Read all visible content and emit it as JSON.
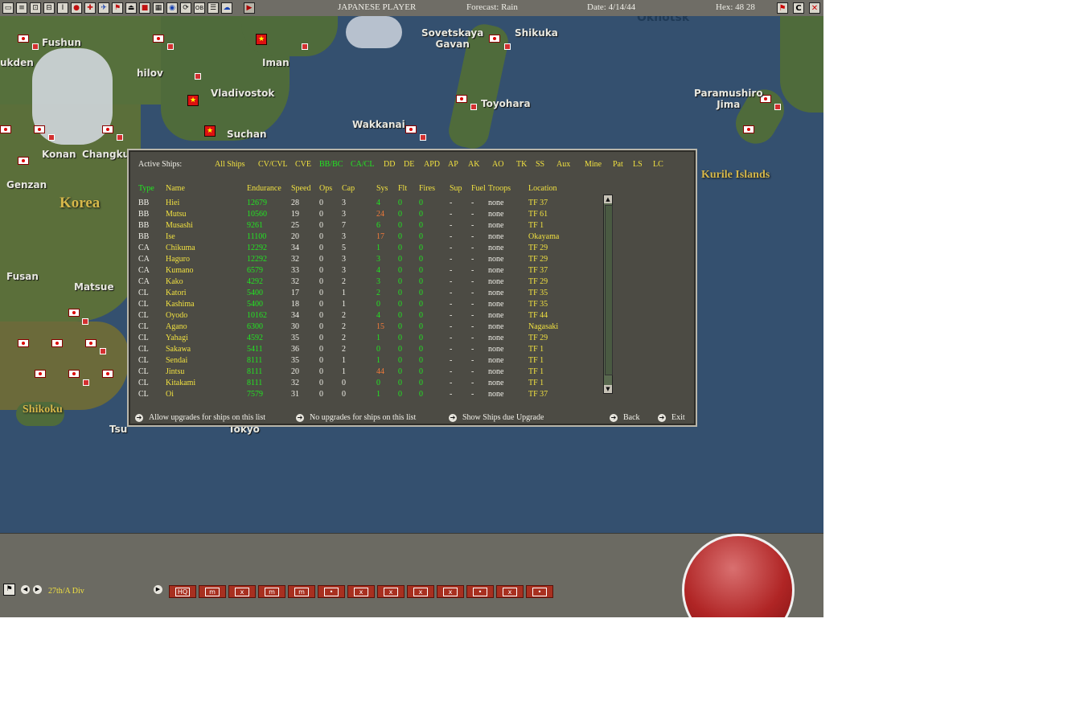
{
  "topbar": {
    "player": "JAPANESE PLAYER",
    "forecast": "Forecast: Rain",
    "date": "Date: 4/14/44",
    "hex": "Hex: 48  28",
    "icons": [
      "map-icon",
      "report-icon",
      "tf-icon",
      "ship-icon",
      "info-icon",
      "flag-jp-icon",
      "air-icon",
      "plane-icon",
      "fortify-icon",
      "sub-icon",
      "balance-icon",
      "grid-icon",
      "globe-icon",
      "cycle-icon",
      "ob-icon",
      "list-icon",
      "cloud-icon",
      "play-icon"
    ],
    "right_icons": [
      "flag-icon",
      "c-icon",
      "close-icon"
    ]
  },
  "map": {
    "cities": [
      {
        "name": "Fushun"
      },
      {
        "name": "ukden"
      },
      {
        "name": "hilov"
      },
      {
        "name": "Vladivostok"
      },
      {
        "name": "Iman"
      },
      {
        "name": "Sovetskaya\nGavan"
      },
      {
        "name": "Shikuka"
      },
      {
        "name": "Toyohara"
      },
      {
        "name": "Paramushiro\nJima"
      },
      {
        "name": "Suchan"
      },
      {
        "name": "Wakkanai"
      },
      {
        "name": "Konan"
      },
      {
        "name": "Changkufe"
      },
      {
        "name": "Genzan"
      },
      {
        "name": "Fusan"
      },
      {
        "name": "Matsue"
      },
      {
        "name": "Tokyo"
      },
      {
        "name": "Tsu"
      },
      {
        "name": "Okhotsk"
      }
    ],
    "regions": [
      {
        "name": "Korea"
      },
      {
        "name": "Kurile Islands"
      },
      {
        "name": "Shikoku"
      }
    ]
  },
  "dialog": {
    "active_label": "Active Ships:",
    "filters": [
      {
        "label": "All Ships",
        "color": "yellow"
      },
      {
        "label": "CV/CVL",
        "color": "yellow"
      },
      {
        "label": "CVE",
        "color": "yellow"
      },
      {
        "label": "BB/BC",
        "color": "green"
      },
      {
        "label": "CA/CL",
        "color": "green"
      },
      {
        "label": "DD",
        "color": "yellow"
      },
      {
        "label": "DE",
        "color": "yellow"
      },
      {
        "label": "APD",
        "color": "yellow"
      },
      {
        "label": "AP",
        "color": "yellow"
      },
      {
        "label": "AK",
        "color": "yellow"
      },
      {
        "label": "AO",
        "color": "yellow"
      },
      {
        "label": "TK",
        "color": "yellow"
      },
      {
        "label": "SS",
        "color": "yellow"
      },
      {
        "label": "Aux",
        "color": "yellow"
      },
      {
        "label": "Mine",
        "color": "yellow"
      },
      {
        "label": "Pat",
        "color": "yellow"
      },
      {
        "label": "LS",
        "color": "yellow"
      },
      {
        "label": "LC",
        "color": "yellow"
      }
    ],
    "columns": [
      "Type",
      "Name",
      "Endurance",
      "Speed",
      "Ops",
      "Cap",
      "Sys",
      "Flt",
      "Fires",
      "Sup",
      "Fuel",
      "Troops",
      "Location"
    ],
    "rows": [
      [
        "BB",
        "Hiei",
        "12679",
        "28",
        "0",
        "3",
        "4",
        "0",
        "0",
        "-",
        "-",
        "none",
        "TF 37"
      ],
      [
        "BB",
        "Mutsu",
        "10560",
        "19",
        "0",
        "3",
        "24",
        "0",
        "0",
        "-",
        "-",
        "none",
        "TF 61"
      ],
      [
        "BB",
        "Musashi",
        "9261",
        "25",
        "0",
        "7",
        "6",
        "0",
        "0",
        "-",
        "-",
        "none",
        "TF 1"
      ],
      [
        "BB",
        "Ise",
        "11100",
        "20",
        "0",
        "3",
        "17",
        "0",
        "0",
        "-",
        "-",
        "none",
        "Okayama"
      ],
      [
        "CA",
        "Chikuma",
        "12292",
        "34",
        "0",
        "5",
        "1",
        "0",
        "0",
        "-",
        "-",
        "none",
        "TF 29"
      ],
      [
        "CA",
        "Haguro",
        "12292",
        "32",
        "0",
        "3",
        "3",
        "0",
        "0",
        "-",
        "-",
        "none",
        "TF 29"
      ],
      [
        "CA",
        "Kumano",
        "6579",
        "33",
        "0",
        "3",
        "4",
        "0",
        "0",
        "-",
        "-",
        "none",
        "TF 37"
      ],
      [
        "CA",
        "Kako",
        "4292",
        "32",
        "0",
        "2",
        "3",
        "0",
        "0",
        "-",
        "-",
        "none",
        "TF 29"
      ],
      [
        "CL",
        "Katori",
        "5400",
        "17",
        "0",
        "1",
        "2",
        "0",
        "0",
        "-",
        "-",
        "none",
        "TF 35"
      ],
      [
        "CL",
        "Kashima",
        "5400",
        "18",
        "0",
        "1",
        "0",
        "0",
        "0",
        "-",
        "-",
        "none",
        "TF 35"
      ],
      [
        "CL",
        "Oyodo",
        "10162",
        "34",
        "0",
        "2",
        "4",
        "0",
        "0",
        "-",
        "-",
        "none",
        "TF 44"
      ],
      [
        "CL",
        "Agano",
        "6300",
        "30",
        "0",
        "2",
        "15",
        "0",
        "0",
        "-",
        "-",
        "none",
        "Nagasaki"
      ],
      [
        "CL",
        "Yahagi",
        "4592",
        "35",
        "0",
        "2",
        "1",
        "0",
        "0",
        "-",
        "-",
        "none",
        "TF 29"
      ],
      [
        "CL",
        "Sakawa",
        "5411",
        "36",
        "0",
        "2",
        "0",
        "0",
        "0",
        "-",
        "-",
        "none",
        "TF 1"
      ],
      [
        "CL",
        "Sendai",
        "8111",
        "35",
        "0",
        "1",
        "1",
        "0",
        "0",
        "-",
        "-",
        "none",
        "TF 1"
      ],
      [
        "CL",
        "Jintsu",
        "8111",
        "20",
        "0",
        "1",
        "44",
        "0",
        "0",
        "-",
        "-",
        "none",
        "TF 1"
      ],
      [
        "CL",
        "Kitakami",
        "8111",
        "32",
        "0",
        "0",
        "0",
        "0",
        "0",
        "-",
        "-",
        "none",
        "TF 1"
      ],
      [
        "CL",
        "Oi",
        "7579",
        "31",
        "0",
        "0",
        "1",
        "0",
        "0",
        "-",
        "-",
        "none",
        "TF 37"
      ]
    ],
    "footer": {
      "allow": "Allow upgrades for ships on this list",
      "no": "No upgrades for ships on this list",
      "show": "Show Ships due Upgrade",
      "back": "Back",
      "exit": "Exit"
    }
  },
  "bottom": {
    "unit_name": "27th/A Div",
    "unit_symbols": [
      "HQ",
      "m",
      "x",
      "m",
      "m",
      "•",
      "x",
      "x",
      "x",
      "x",
      "•",
      "x",
      "•"
    ]
  }
}
